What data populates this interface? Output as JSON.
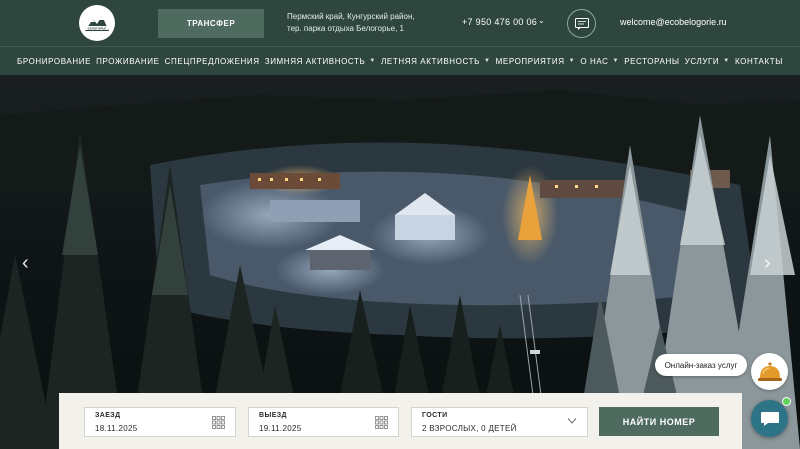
{
  "header": {
    "logo_text": "БЕЛОГОРЬЕ",
    "transfer_label": "ТРАНСФЕР",
    "address_line1": "Пермский край, Кунгурский район,",
    "address_line2": "тер. парка отдыха Белогорье, 1",
    "phone": "+7 950 476 00 06",
    "email": "welcome@ecobelogorie.ru"
  },
  "nav": {
    "items": [
      {
        "label": "БРОНИРОВАНИЕ",
        "has_dropdown": false
      },
      {
        "label": "ПРОЖИВАНИЕ",
        "has_dropdown": false
      },
      {
        "label": "СПЕЦПРЕДЛОЖЕНИЯ",
        "has_dropdown": false
      },
      {
        "label": "ЗИМНЯЯ АКТИВНОСТЬ",
        "has_dropdown": true
      },
      {
        "label": "ЛЕТНЯЯ АКТИВНОСТЬ",
        "has_dropdown": true
      },
      {
        "label": "МЕРОПРИЯТИЯ",
        "has_dropdown": true
      },
      {
        "label": "О НАС",
        "has_dropdown": true
      },
      {
        "label": "РЕСТОРАНЫ",
        "has_dropdown": false
      },
      {
        "label": "УСЛУГИ",
        "has_dropdown": true
      },
      {
        "label": "КОНТАКТЫ",
        "has_dropdown": false
      }
    ]
  },
  "booking": {
    "checkin_label": "ЗАЕЗД",
    "checkin_value": "18.11.2025",
    "checkout_label": "ВЫЕЗД",
    "checkout_value": "19.11.2025",
    "guests_label": "ГОСТИ",
    "guests_value": "2 ВЗРОСЛЫХ, 0 ДЕТЕЙ",
    "search_label": "НАЙТИ НОМЕР"
  },
  "widgets": {
    "order_tooltip": "Онлайн-заказ услуг"
  },
  "icons": {
    "dropdown": "chevron-down-icon",
    "chat": "chat-bubble-icon",
    "calendar": "calendar-grid-icon",
    "bell": "service-bell-icon",
    "slider_prev": "chevron-left-icon",
    "slider_next": "chevron-right-icon"
  },
  "colors": {
    "header_bg": "#2e463d",
    "button_bg": "#4f6b5f",
    "chat_widget": "#2e7487",
    "online_dot": "#5fd35a"
  }
}
